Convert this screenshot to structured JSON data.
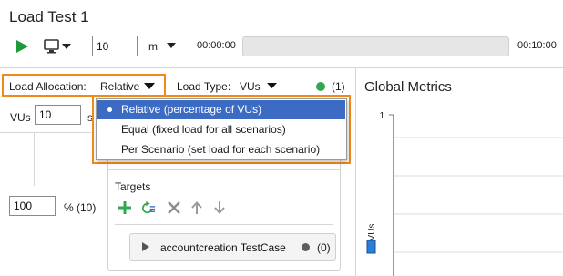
{
  "window": {
    "title": "Load Test 1"
  },
  "toolbar": {
    "duration_value": "10",
    "duration_unit": "m",
    "elapsed": "00:00:00",
    "total": "00:10:00",
    "progress": 0
  },
  "allocation": {
    "label": "Load Allocation:",
    "value": "Relative",
    "menu": [
      {
        "label": "Relative (percentage of VUs)",
        "selected": true
      },
      {
        "label": "Equal (fixed load for all scenarios)",
        "selected": false
      },
      {
        "label": "Per Scenario (set load for each scenario)",
        "selected": false
      }
    ]
  },
  "load_type": {
    "label": "Load Type:",
    "value": "VUs",
    "count": "(1)",
    "status_color": "#2fa84f"
  },
  "vus": {
    "label": "VUs",
    "value": "10",
    "trailing": "s"
  },
  "scenario": {
    "percent_value": "100",
    "percent_label": "% (10)",
    "targets_title": "Targets",
    "tools": [
      "add-icon",
      "refresh-list-icon",
      "delete-icon",
      "move-up-icon",
      "move-down-icon"
    ],
    "target": {
      "name": "accountcreation TestCase",
      "count": "(0)"
    }
  },
  "metrics": {
    "title": "Global Metrics"
  },
  "chart_data": {
    "type": "line",
    "title": "",
    "ylabel": "VUs",
    "xlabel": "",
    "y_tick_top": "1",
    "ylim": [
      0,
      1
    ],
    "grid": true,
    "series": [],
    "legend_color": "#2b7fd8"
  },
  "colors": {
    "highlight": "#f28a1b",
    "menu_selected": "#3c6bc4",
    "play": "#1f9a3b"
  }
}
